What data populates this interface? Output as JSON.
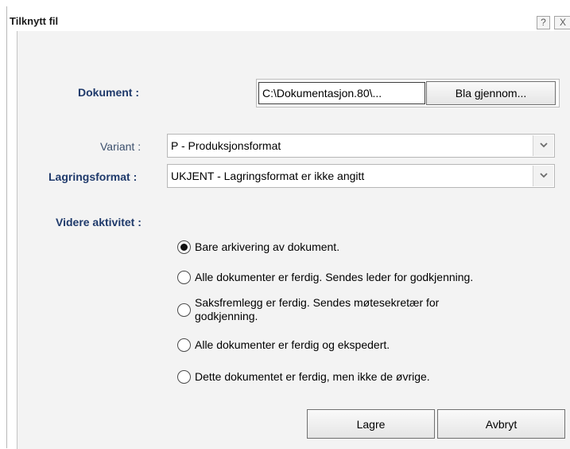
{
  "window": {
    "title": "Tilknytt fil",
    "help_glyph": "?",
    "close_glyph": "X"
  },
  "form": {
    "document_label": "Dokument :",
    "document_path": "C:\\Dokumentasjon.80\\...",
    "browse_label": "Bla gjennom...",
    "variant_label": "Variant :",
    "variant_value": "P - Produksjonsformat",
    "storage_label": "Lagringsformat :",
    "storage_value": "UKJENT - Lagringsformat er ikke angitt",
    "activity_label": "Videre aktivitet :",
    "activities": [
      {
        "label": "Bare arkivering av dokument.",
        "selected": true
      },
      {
        "label": "Alle dokumenter er ferdig. Sendes leder for godkjenning.",
        "selected": false
      },
      {
        "label_line1": "Saksfremlegg er ferdig. Sendes møtesekretær for",
        "label_line2": "godkjenning.",
        "selected": false
      },
      {
        "label": "Alle dokumenter er ferdig og ekspedert.",
        "selected": false
      },
      {
        "label": "Dette dokumentet er ferdig, men ikke de øvrige.",
        "selected": false
      }
    ]
  },
  "buttons": {
    "save_label": "Lagre",
    "cancel_label": "Avbryt"
  },
  "icons": {
    "help": "help-icon",
    "close": "close-icon",
    "dropdown": "chevron-down-icon"
  }
}
